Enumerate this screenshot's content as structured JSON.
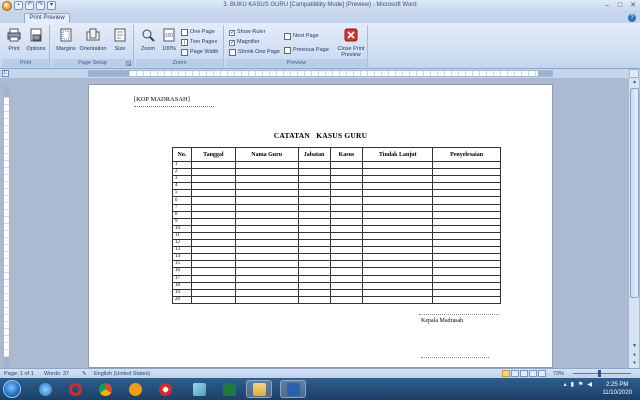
{
  "window": {
    "title": "3. BUKU KASUS GURU [Compatibility Mode] (Preview) - Microsoft Word",
    "controls": [
      "–",
      "□",
      "✕"
    ]
  },
  "ribbon": {
    "tab": "Print Preview",
    "groups": {
      "print": {
        "label": "Print",
        "buttons": [
          "Print",
          "Options"
        ]
      },
      "page_setup": {
        "label": "Page Setup",
        "buttons": [
          "Margins",
          "Orientation",
          "Size"
        ]
      },
      "zoom": {
        "label": "Zoom",
        "buttons": [
          "Zoom",
          "100%",
          "One Page",
          "Two Pages",
          "Page Width"
        ]
      },
      "preview": {
        "label": "Preview",
        "checks": [
          {
            "label": "Show Ruler",
            "checked": true
          },
          {
            "label": "Magnifier",
            "checked": true
          }
        ],
        "shrink": "Shrink One Page",
        "next": "Next Page",
        "previous": "Previous Page",
        "close": "Close Print Preview"
      }
    }
  },
  "document": {
    "kop": "[KOP MADRASAH]",
    "title": "CATATAN   KASUS GURU",
    "columns": [
      "No.",
      "Tanggal",
      "Nama Guru",
      "Jabatan",
      "Kasus",
      "Tindak Lanjut",
      "Penyelesaian"
    ],
    "rows": [
      "1",
      "2",
      "3",
      "4",
      "5",
      "6",
      "7",
      "8",
      "9",
      "10",
      "11",
      "12",
      "13",
      "14",
      "15",
      "16",
      "17",
      "18",
      "19",
      "20"
    ],
    "signer": "Kepala Madrasah"
  },
  "status": {
    "page": "Page: 1 of 1",
    "words": "Words: 37",
    "language": "English (United States)",
    "zoom": "73%"
  },
  "taskbar": {
    "time": "2:25 PM",
    "date": "11/10/2020"
  }
}
